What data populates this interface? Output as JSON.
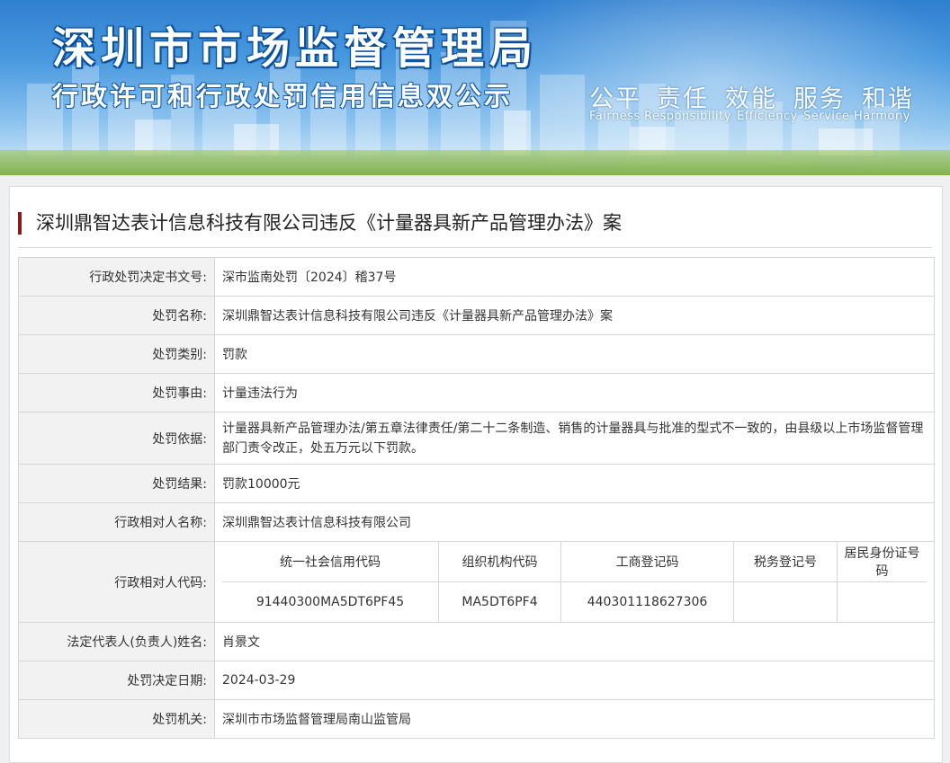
{
  "banner": {
    "title": "深圳市市场监督管理局",
    "subtitle": "行政许可和行政处罚信用信息双公示",
    "slogans": [
      {
        "cn": "公平",
        "en": "Fairness"
      },
      {
        "cn": "责任",
        "en": "Responsibility"
      },
      {
        "cn": "效能",
        "en": "Efficiency"
      },
      {
        "cn": "服务",
        "en": "Service"
      },
      {
        "cn": "和谐",
        "en": "Harmony"
      }
    ]
  },
  "case": {
    "title": "深圳鼎智达表计信息科技有限公司违反《计量器具新产品管理办法》案",
    "fields": [
      {
        "label": "行政处罚决定书文号:",
        "value": "深市监南处罚〔2024〕稽37号"
      },
      {
        "label": "处罚名称:",
        "value": "深圳鼎智达表计信息科技有限公司违反《计量器具新产品管理办法》案"
      },
      {
        "label": "处罚类别:",
        "value": "罚款"
      },
      {
        "label": "处罚事由:",
        "value": "计量违法行为"
      },
      {
        "label": "处罚依据:",
        "value": "计量器具新产品管理办法/第五章法律责任/第二十二条制造、销售的计量器具与批准的型式不一致的，由县级以上市场监督管理部门责令改正，处五万元以下罚款。"
      },
      {
        "label": "处罚结果:",
        "value": "罚款10000元"
      },
      {
        "label": "行政相对人名称:",
        "value": "深圳鼎智达表计信息科技有限公司"
      }
    ],
    "codes": {
      "label": "行政相对人代码:",
      "headers": [
        "统一社会信用代码",
        "组织机构代码",
        "工商登记码",
        "税务登记号",
        "居民身份证号码"
      ],
      "values": [
        "91440300MA5DT6PF45",
        "MA5DT6PF4",
        "440301118627306",
        "",
        ""
      ]
    },
    "fields_after": [
      {
        "label": "法定代表人(负责人)姓名:",
        "value": "肖景文"
      },
      {
        "label": "处罚决定日期:",
        "value": "2024-03-29"
      },
      {
        "label": "处罚机关:",
        "value": "深圳市市场监督管理局南山监管局"
      }
    ]
  },
  "colors": {
    "accent": "#8b1a1a",
    "label_bg": "#f2f2f2",
    "banner_blue": "#2f7fd0"
  }
}
